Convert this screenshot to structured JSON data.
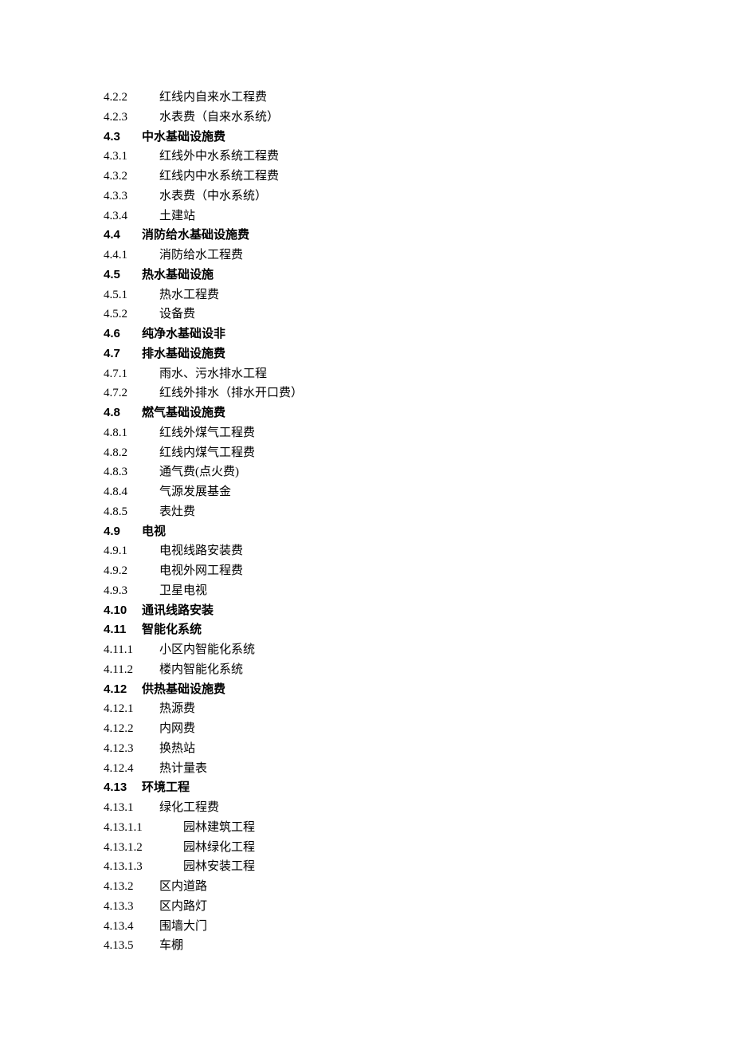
{
  "items": [
    {
      "num": "4.2.2",
      "label": "红线内自来水工程费",
      "depth": 1,
      "bold": false
    },
    {
      "num": "4.2.3",
      "label": "水表费（自来水系统）",
      "depth": 1,
      "bold": false
    },
    {
      "num": "4.3",
      "label": "中水基础设施费",
      "depth": 0,
      "bold": true
    },
    {
      "num": "4.3.1",
      "label": "红线外中水系统工程费",
      "depth": 1,
      "bold": false
    },
    {
      "num": "4.3.2",
      "label": "红线内中水系统工程费",
      "depth": 1,
      "bold": false
    },
    {
      "num": "4.3.3",
      "label": "水表费（中水系统）",
      "depth": 1,
      "bold": false
    },
    {
      "num": "4.3.4",
      "label": "土建站",
      "depth": 1,
      "bold": false
    },
    {
      "num": "4.4",
      "label": "消防给水基础设施费",
      "depth": 0,
      "bold": true
    },
    {
      "num": "4.4.1",
      "label": "消防给水工程费",
      "depth": 1,
      "bold": false
    },
    {
      "num": "4.5",
      "label": "热水基础设施",
      "depth": 0,
      "bold": true
    },
    {
      "num": "4.5.1",
      "label": "热水工程费",
      "depth": 1,
      "bold": false
    },
    {
      "num": "4.5.2",
      "label": "设备费",
      "depth": 1,
      "bold": false
    },
    {
      "num": "4.6",
      "label": "纯净水基础设非",
      "depth": 0,
      "bold": true
    },
    {
      "num": "4.7",
      "label": "排水基础设施费",
      "depth": 0,
      "bold": true
    },
    {
      "num": "4.7.1",
      "label": "雨水、污水排水工程",
      "depth": 1,
      "bold": false
    },
    {
      "num": "4.7.2",
      "label": "红线外排水（排水开口费）",
      "depth": 1,
      "bold": false
    },
    {
      "num": "4.8",
      "label": "燃气基础设施费",
      "depth": 0,
      "bold": true
    },
    {
      "num": "4.8.1",
      "label": "红线外煤气工程费",
      "depth": 1,
      "bold": false
    },
    {
      "num": "4.8.2",
      "label": "红线内煤气工程费",
      "depth": 1,
      "bold": false
    },
    {
      "num": "4.8.3",
      "label": "通气费(点火费)",
      "depth": 1,
      "bold": false
    },
    {
      "num": "4.8.4",
      "label": "气源发展基金",
      "depth": 1,
      "bold": false
    },
    {
      "num": "4.8.5",
      "label": "表灶费",
      "depth": 1,
      "bold": false
    },
    {
      "num": "4.9",
      "label": "电视",
      "depth": 0,
      "bold": true
    },
    {
      "num": "4.9.1",
      "label": "电视线路安装费",
      "depth": 1,
      "bold": false
    },
    {
      "num": "4.9.2",
      "label": "电视外网工程费",
      "depth": 1,
      "bold": false
    },
    {
      "num": "4.9.3",
      "label": "卫星电视",
      "depth": 1,
      "bold": false
    },
    {
      "num": "4.10",
      "label": "通讯线路安装",
      "depth": 0,
      "bold": true
    },
    {
      "num": "4.11",
      "label": "智能化系统",
      "depth": 0,
      "bold": true
    },
    {
      "num": "4.11.1",
      "label": "小区内智能化系统",
      "depth": 1,
      "bold": false
    },
    {
      "num": "4.11.2",
      "label": "楼内智能化系统",
      "depth": 1,
      "bold": false
    },
    {
      "num": "4.12",
      "label": "供热基础设施费",
      "depth": 0,
      "bold": true
    },
    {
      "num": "4.12.1",
      "label": "热源费",
      "depth": 1,
      "bold": false
    },
    {
      "num": "4.12.2",
      "label": "内网费",
      "depth": 1,
      "bold": false
    },
    {
      "num": "4.12.3",
      "label": "换热站",
      "depth": 1,
      "bold": false
    },
    {
      "num": "4.12.4",
      "label": "热计量表",
      "depth": 1,
      "bold": false
    },
    {
      "num": "4.13",
      "label": "环境工程",
      "depth": 0,
      "bold": true
    },
    {
      "num": "4.13.1",
      "label": "绿化工程费",
      "depth": 1,
      "bold": false
    },
    {
      "num": "4.13.1.1",
      "label": "园林建筑工程",
      "depth": 2,
      "bold": false
    },
    {
      "num": "4.13.1.2",
      "label": "园林绿化工程",
      "depth": 2,
      "bold": false
    },
    {
      "num": "4.13.1.3",
      "label": "园林安装工程",
      "depth": 2,
      "bold": false
    },
    {
      "num": "4.13.2",
      "label": "区内道路",
      "depth": 1,
      "bold": false
    },
    {
      "num": "4.13.3",
      "label": "区内路灯",
      "depth": 1,
      "bold": false
    },
    {
      "num": "4.13.4",
      "label": "围墙大门",
      "depth": 1,
      "bold": false
    },
    {
      "num": "4.13.5",
      "label": "车棚",
      "depth": 1,
      "bold": false
    }
  ]
}
